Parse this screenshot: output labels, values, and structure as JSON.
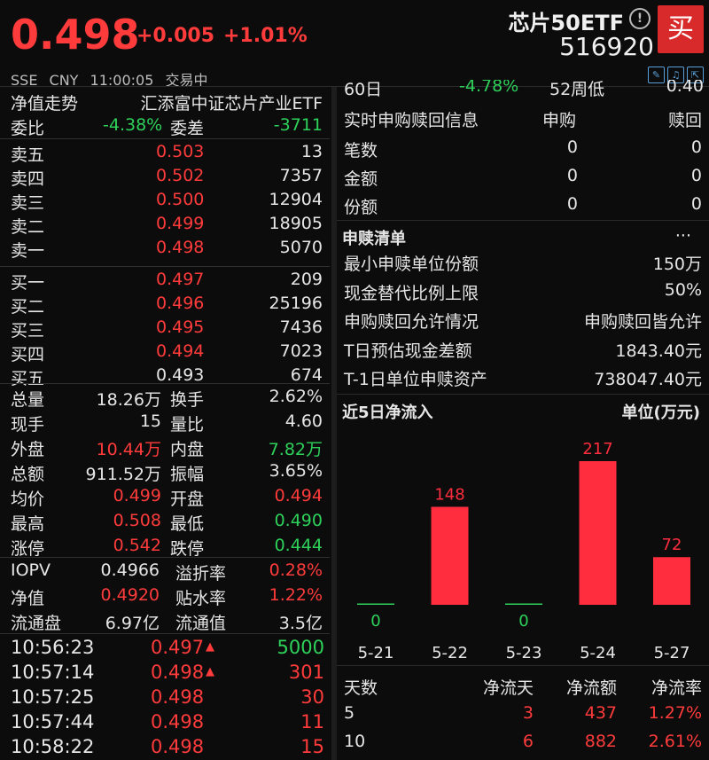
{
  "header": {
    "price": "0.498",
    "change": "+0.005",
    "change_pct": "+1.01%",
    "name": "芯片50ETF",
    "code": "516920",
    "buy_label": "买",
    "exchange": "SSE",
    "currency": "CNY",
    "time": "11:00:05",
    "status": "交易中",
    "info_icon": "info-icon",
    "tool_icons": [
      "edit-icon",
      "bell-icon",
      "share-icon"
    ]
  },
  "left": {
    "nav_label": "净值走势",
    "nav_index": "汇添富中证芯片产业ETF",
    "weibi_label": "委比",
    "weibi_value": "-4.38%",
    "weicha_label": "委差",
    "weicha_value": "-3711",
    "sells": [
      {
        "label": "卖五",
        "price": "0.503",
        "volume": "13"
      },
      {
        "label": "卖四",
        "price": "0.502",
        "volume": "7357"
      },
      {
        "label": "卖三",
        "price": "0.500",
        "volume": "12904"
      },
      {
        "label": "卖二",
        "price": "0.499",
        "volume": "18905"
      },
      {
        "label": "卖一",
        "price": "0.498",
        "volume": "5070"
      }
    ],
    "buys": [
      {
        "label": "买一",
        "price": "0.497",
        "volume": "209"
      },
      {
        "label": "买二",
        "price": "0.496",
        "volume": "25196"
      },
      {
        "label": "买三",
        "price": "0.495",
        "volume": "7436"
      },
      {
        "label": "买四",
        "price": "0.494",
        "volume": "7023"
      },
      {
        "label": "买五",
        "price": "0.493",
        "volume": "674"
      }
    ],
    "stats": [
      {
        "l1": "总量",
        "v1": "18.26万",
        "l2": "换手",
        "v2": "2.62%"
      },
      {
        "l1": "现手",
        "v1": "15",
        "l2": "量比",
        "v2": "4.60"
      },
      {
        "l1": "外盘",
        "v1": "10.44万",
        "l2": "内盘",
        "v2": "7.82万"
      },
      {
        "l1": "总额",
        "v1": "911.52万",
        "l2": "振幅",
        "v2": "3.65%"
      },
      {
        "l1": "均价",
        "v1": "0.499",
        "l2": "开盘",
        "v2": "0.494"
      },
      {
        "l1": "最高",
        "v1": "0.508",
        "l2": "最低",
        "v2": "0.490"
      },
      {
        "l1": "涨停",
        "v1": "0.542",
        "l2": "跌停",
        "v2": "0.444"
      }
    ],
    "stats2": [
      {
        "l1": "IOPV",
        "v1": "0.4966",
        "l2": "溢折率",
        "v2": "0.28%"
      },
      {
        "l1": "净值",
        "v1": "0.4920",
        "l2": "贴水率",
        "v2": "1.22%"
      },
      {
        "l1": "流通盘",
        "v1": "6.97亿",
        "l2": "流通值",
        "v2": "3.5亿"
      }
    ],
    "ticks": [
      {
        "time": "10:56:23",
        "price": "0.497",
        "arrow": "▲",
        "vol": "5000"
      },
      {
        "time": "10:57:14",
        "price": "0.498",
        "arrow": "▲",
        "vol": "301"
      },
      {
        "time": "10:57:25",
        "price": "0.498",
        "arrow": "",
        "vol": "30"
      },
      {
        "time": "10:57:44",
        "price": "0.498",
        "arrow": "",
        "vol": "11"
      },
      {
        "time": "10:58:22",
        "price": "0.498",
        "arrow": "",
        "vol": "15"
      }
    ]
  },
  "right": {
    "top_partial": {
      "l1": "60日",
      "v1": "-4.78%",
      "l2": "52周低",
      "v2": "0.40"
    },
    "rt_header": {
      "title": "实时申购赎回信息",
      "col1": "申购",
      "col2": "赎回"
    },
    "rt_rows": [
      {
        "label": "笔数",
        "sub": "0",
        "red": "0"
      },
      {
        "label": "金额",
        "sub": "0",
        "red": "0"
      },
      {
        "label": "份额",
        "sub": "0",
        "red": "0"
      }
    ],
    "list_title": "申赎清单",
    "list_more": "···",
    "list_rows": [
      {
        "label": "最小申赎单位份额",
        "value": "150万"
      },
      {
        "label": "现金替代比例上限",
        "value": "50%"
      },
      {
        "label": "申购赎回允许情况",
        "value": "申购赎回皆允许"
      },
      {
        "label": "T日预估现金差额",
        "value": "1843.40元"
      },
      {
        "label": "T-1日单位申赎资产",
        "value": "738047.40元"
      }
    ],
    "flow_title": "近5日净流入",
    "flow_unit": "单位(万元)",
    "table_header": {
      "c1": "天数",
      "c2": "净流天",
      "c3": "净流额",
      "c4": "净流率"
    },
    "table_rows": [
      {
        "c1": "5",
        "c2": "3",
        "c3": "437",
        "c4": "1.27%"
      },
      {
        "c1": "10",
        "c2": "6",
        "c3": "882",
        "c4": "2.61%"
      }
    ]
  },
  "chart_data": {
    "type": "bar",
    "categories": [
      "5-21",
      "5-22",
      "5-23",
      "5-24",
      "5-27"
    ],
    "values": [
      0,
      148,
      0,
      217,
      72
    ],
    "title": "近5日净流入",
    "ylabel": "单位(万元)",
    "colors": {
      "positive": "#ff2d3d",
      "zero": "#2ed15a"
    }
  },
  "colors": {
    "up": "#ff3b3b",
    "down": "#2ed15a",
    "background": "#0c0c0c",
    "buy_button": "#d82a2a"
  }
}
